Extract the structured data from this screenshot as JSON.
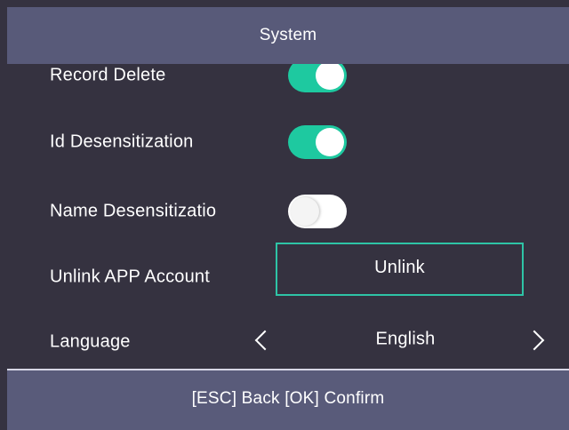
{
  "header": {
    "title": "System"
  },
  "settings": {
    "record_delete": {
      "label": "Record Delete",
      "enabled": true
    },
    "id_desensitization": {
      "label": "Id Desensitization",
      "enabled": true
    },
    "name_desensitization": {
      "label": "Name Desensitizatio",
      "enabled": false
    },
    "unlink_app_account": {
      "label": "Unlink APP Account",
      "button_label": "Unlink"
    },
    "language": {
      "label": "Language",
      "value": "English"
    }
  },
  "footer": {
    "hint": "[ESC] Back [OK] Confirm"
  },
  "colors": {
    "toggle_on": "#1ec9a0",
    "accent_border": "#2ec4a6",
    "header_bg": "#585a79",
    "body_bg": "#353240"
  }
}
